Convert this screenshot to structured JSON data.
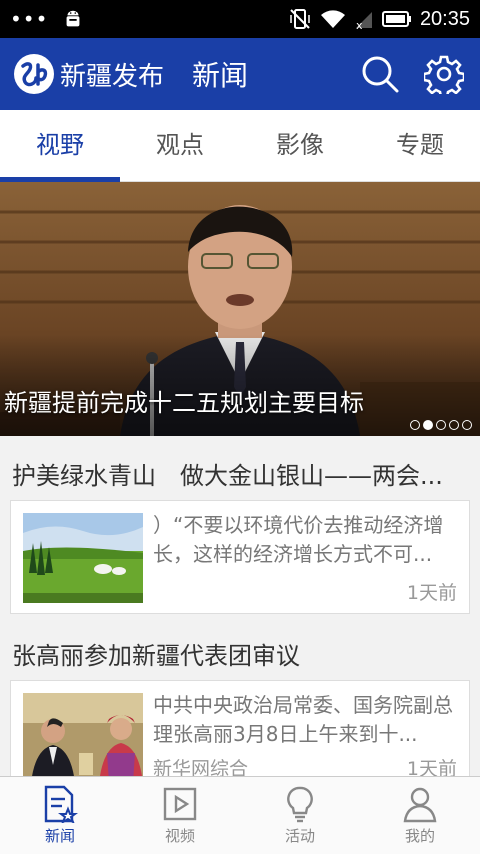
{
  "status_bar": {
    "time": "20:35"
  },
  "app": {
    "brand": "新疆发布",
    "section": "新闻",
    "logo_text": "新"
  },
  "tabs": [
    {
      "label": "视野",
      "active": true
    },
    {
      "label": "观点",
      "active": false
    },
    {
      "label": "影像",
      "active": false
    },
    {
      "label": "专题",
      "active": false
    }
  ],
  "hero": {
    "caption": "新疆提前完成十二五规划主要目标",
    "page_count": 5,
    "current_page": 2
  },
  "articles": [
    {
      "title": "护美绿水青山　做大金山银山——两会...",
      "summary": "）“不要以环境代价去推动经济增长，这样的经济增长方式不可...",
      "source": "",
      "time": "1天前"
    },
    {
      "title": "张高丽参加新疆代表团审议",
      "summary": "中共中央政治局常委、国务院副总理张高丽3月8日上午来到十...",
      "source": "新华网综合",
      "time": "1天前"
    }
  ],
  "bottom_nav": [
    {
      "label": "新闻",
      "icon": "news-icon",
      "active": true
    },
    {
      "label": "视频",
      "icon": "video-icon",
      "active": false
    },
    {
      "label": "活动",
      "icon": "activity-icon",
      "active": false
    },
    {
      "label": "我的",
      "icon": "profile-icon",
      "active": false
    }
  ],
  "colors": {
    "brand": "#1a3fa7",
    "status_bar": "#000000"
  }
}
